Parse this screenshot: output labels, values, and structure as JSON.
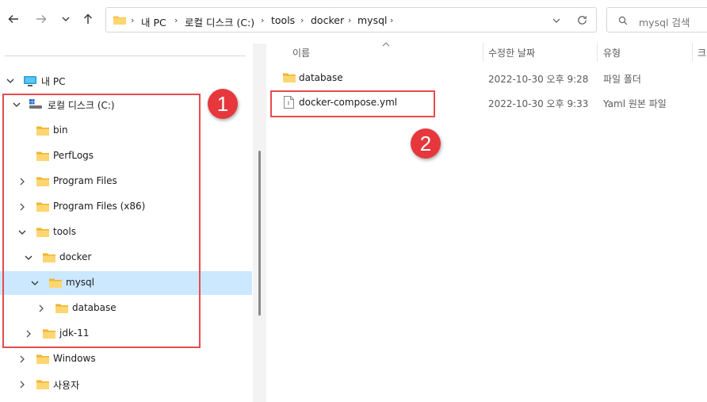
{
  "toolbar": {
    "back_icon": "arrow-left-icon",
    "forward_icon": "arrow-right-icon",
    "recent_icon": "chevron-down-icon",
    "up_icon": "arrow-up-icon"
  },
  "address_bar": {
    "crumbs": [
      "내 PC",
      "로컬 디스크 (C:)",
      "tools",
      "docker",
      "mysql"
    ],
    "refresh_icon": "refresh-icon"
  },
  "search": {
    "placeholder": "mysql 검색"
  },
  "tree": {
    "items": [
      {
        "label": "내 PC",
        "icon": "pc-icon"
      },
      {
        "label": "로컬 디스크 (C:)",
        "icon": "drive-icon"
      },
      {
        "label": "bin"
      },
      {
        "label": "PerfLogs"
      },
      {
        "label": "Program Files"
      },
      {
        "label": "Program Files (x86)"
      },
      {
        "label": "tools"
      },
      {
        "label": "docker"
      },
      {
        "label": "mysql"
      },
      {
        "label": "database"
      },
      {
        "label": "jdk-11"
      },
      {
        "label": "Windows"
      },
      {
        "label": "사용자"
      }
    ]
  },
  "columns": {
    "name": "이름",
    "date": "수정한 날짜",
    "type": "유형",
    "size": "크"
  },
  "files": [
    {
      "name": "database",
      "date": "2022-10-30 오후 9:28",
      "type": "파일 폴더"
    },
    {
      "name": "docker-compose.yml",
      "date": "2022-10-30 오후 9:33",
      "type": "Yaml 원본 파일"
    }
  ],
  "annotations": {
    "badge1": "1",
    "badge2": "2",
    "highlight_color": "#e84a4e"
  },
  "colors": {
    "selected": "#cce8ff",
    "folder": "#f8c34a"
  }
}
